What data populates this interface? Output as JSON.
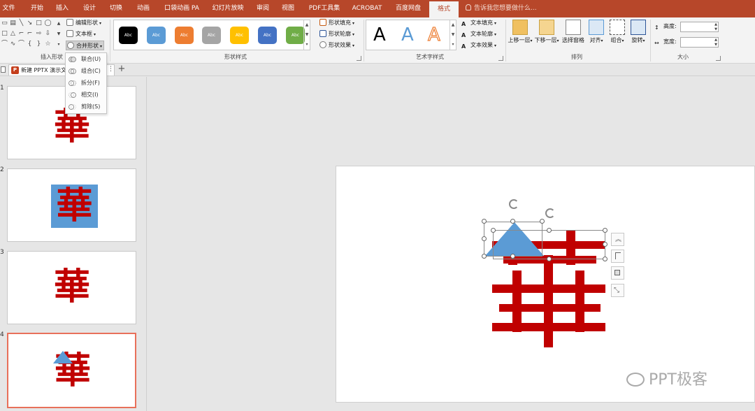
{
  "tabs": [
    {
      "label": "文件",
      "active": false
    },
    {
      "label": "开始",
      "active": false
    },
    {
      "label": "插入",
      "active": false
    },
    {
      "label": "设计",
      "active": false
    },
    {
      "label": "切换",
      "active": false
    },
    {
      "label": "动画",
      "active": false
    },
    {
      "label": "口袋动画 PA",
      "active": false
    },
    {
      "label": "幻灯片放映",
      "active": false
    },
    {
      "label": "审阅",
      "active": false
    },
    {
      "label": "视图",
      "active": false
    },
    {
      "label": "PDF工具集",
      "active": false
    },
    {
      "label": "ACROBAT",
      "active": false
    },
    {
      "label": "百度网盘",
      "active": false
    },
    {
      "label": "格式",
      "active": true
    }
  ],
  "tell_me": "告诉我您想要做什么...",
  "ribbon": {
    "insert_shapes": {
      "label": "插入形状",
      "edit_shape": "编辑形状",
      "text_box": "文本框",
      "merge_shapes": "合并形状"
    },
    "shape_styles": {
      "label": "形状样式",
      "swatch_text": "Abc",
      "swatches": [
        "#000000",
        "#5b9bd5",
        "#ed7d31",
        "#a5a5a5",
        "#ffc000",
        "#4472c4",
        "#70ad47"
      ],
      "fill": "形状填充",
      "outline": "形状轮廓",
      "effects": "形状效果"
    },
    "wordart": {
      "label": "艺术字样式",
      "letter": "A",
      "text_fill": "文本填充",
      "text_outline": "文本轮廓",
      "text_effects": "文本效果"
    },
    "arrange": {
      "label": "排列",
      "bring_forward": "上移一层",
      "send_backward": "下移一层",
      "selection_pane": "选择窗格",
      "align": "对齐",
      "group": "组合",
      "rotate": "旋转"
    },
    "size": {
      "label": "大小",
      "height_label": "高度:",
      "width_label": "宽度:",
      "height_value": "",
      "width_value": ""
    }
  },
  "merge_menu": {
    "items": [
      "联合(U)",
      "组合(C)",
      "拆分(F)",
      "相交(I)",
      "剪除(S)"
    ]
  },
  "document_tab": "新建 PPTX 演示文稿",
  "thumbnails": [
    {
      "number": "1",
      "char": "華",
      "selected": false
    },
    {
      "number": "2",
      "char": "華",
      "selected": false
    },
    {
      "number": "3",
      "char": "華",
      "selected": false
    },
    {
      "number": "4",
      "char": "華",
      "selected": true
    }
  ],
  "watermark": "PPT极客",
  "colors": {
    "accent": "#b7472a",
    "glyph_red": "#c00000",
    "shape_blue": "#5b9bd5"
  }
}
